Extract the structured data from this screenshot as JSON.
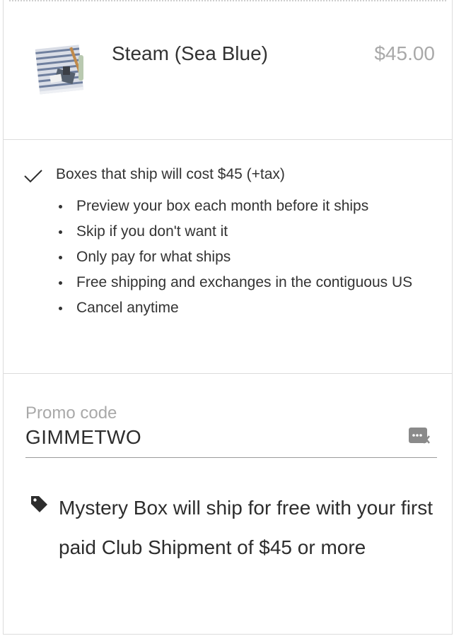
{
  "product": {
    "name": "Steam (Sea Blue)",
    "price": "$45.00",
    "thumbnail_icon": "folded-towel-image"
  },
  "benefits": {
    "headline": "Boxes that ship will cost $45 (+tax)",
    "items": [
      "Preview your box each month before it ships",
      "Skip if you don't want it",
      "Only pay for what ships",
      "Free shipping and exchanges in the contiguous US",
      "Cancel anytime"
    ]
  },
  "promo": {
    "label": "Promo code",
    "value": "GIMMETWO",
    "note": "Mystery Box will ship for free with your first paid Club Shipment of $45 or more"
  },
  "colors": {
    "text": "#2d2d2d",
    "muted": "#a9a9a9",
    "divider": "#dcdcdc"
  }
}
